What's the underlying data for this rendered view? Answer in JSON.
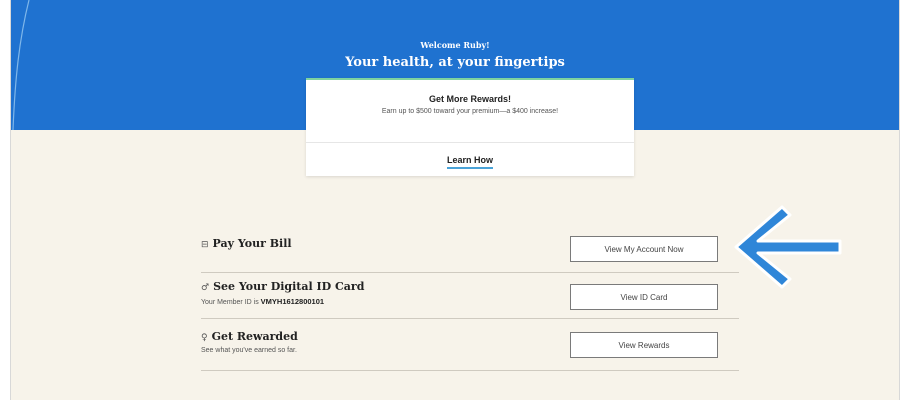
{
  "hero": {
    "welcome": "Welcome Ruby!",
    "tagline": "Your health, at your fingertips",
    "background_color": "#1f72d0"
  },
  "promo": {
    "title": "Get More Rewards!",
    "subtitle": "Earn up to $500 toward your premium—a $400 increase!",
    "link_label": "Learn How"
  },
  "rows": [
    {
      "icon": "credit-card-icon",
      "title": "Pay Your Bill",
      "button": "View My Account Now"
    },
    {
      "icon": "user-icon",
      "title": "See Your Digital ID Card",
      "subtitle_prefix": "Your Member ID is",
      "member_id": "VMYH1612800101",
      "button": "View ID Card"
    },
    {
      "icon": "award-ribbon-icon",
      "title": "Get Rewarded",
      "subtitle": "See what you've earned so far.",
      "button": "View Rewards"
    }
  ],
  "callout": {
    "icon": "left-arrow-icon",
    "color": "#2f86d8"
  }
}
